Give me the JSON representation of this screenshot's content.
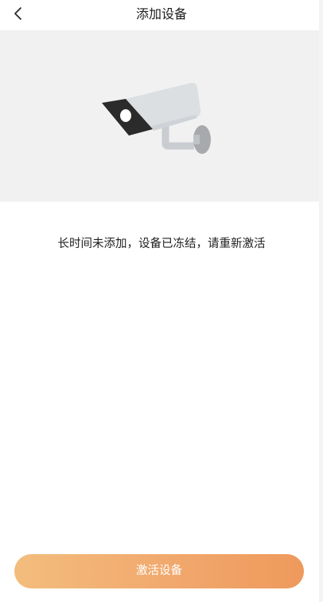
{
  "header": {
    "title": "添加设备",
    "back_icon": "chevron-left-icon"
  },
  "illustration": {
    "icon": "security-camera-icon"
  },
  "message": "长时间未添加，设备已冻结，请重新激活",
  "actions": {
    "activate_label": "激活设备"
  },
  "colors": {
    "hero_bg": "#f1f1f1",
    "button_gradient_start": "#f3bd7d",
    "button_gradient_end": "#ef995c",
    "camera_body": "#dcdfe2",
    "camera_front": "#2b2b2b",
    "camera_mount": "#a7a9ac"
  }
}
